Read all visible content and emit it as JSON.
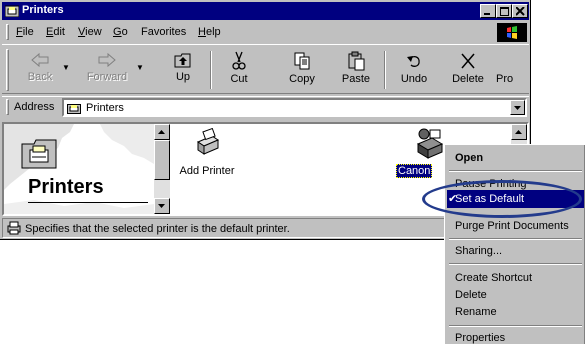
{
  "window": {
    "title": "Printers"
  },
  "menubar": {
    "items": [
      {
        "label": "File",
        "key": "F",
        "rest": "ile"
      },
      {
        "label": "Edit",
        "key": "E",
        "rest": "dit"
      },
      {
        "label": "View",
        "key": "V",
        "rest": "iew"
      },
      {
        "label": "Go",
        "key": "G",
        "rest": "o"
      },
      {
        "label": "Favorites",
        "key": "",
        "rest": "Favorites"
      },
      {
        "label": "Help",
        "key": "H",
        "rest": "elp"
      }
    ]
  },
  "toolbar": {
    "back": "Back",
    "forward": "Forward",
    "up": "Up",
    "cut": "Cut",
    "copy": "Copy",
    "paste": "Paste",
    "undo": "Undo",
    "delete": "Delete",
    "properties_truncated": "Pro"
  },
  "address": {
    "label": "Address",
    "value": "Printers"
  },
  "content": {
    "folder_title": "Printers",
    "items": [
      {
        "label": "Add Printer"
      },
      {
        "label": "Canon"
      }
    ]
  },
  "status": {
    "text": "Specifies that the selected printer is the default printer."
  },
  "context_menu": {
    "items": [
      {
        "label": "Open",
        "bold": true,
        "key": "O"
      },
      {
        "label": "Pause Printing"
      },
      {
        "label": "Set as Default",
        "checked": true,
        "selected": true
      },
      {
        "label": "Purge Print Documents"
      },
      {
        "label": "Sharing..."
      },
      {
        "label": "Create Shortcut"
      },
      {
        "label": "Delete"
      },
      {
        "label": "Rename"
      },
      {
        "label": "Properties"
      }
    ],
    "check_glyph": "✔"
  },
  "colors": {
    "titlebar": "#000080",
    "face": "#c0c0c0",
    "selection": "#000080",
    "annotation_ellipse": "#233b8c"
  }
}
